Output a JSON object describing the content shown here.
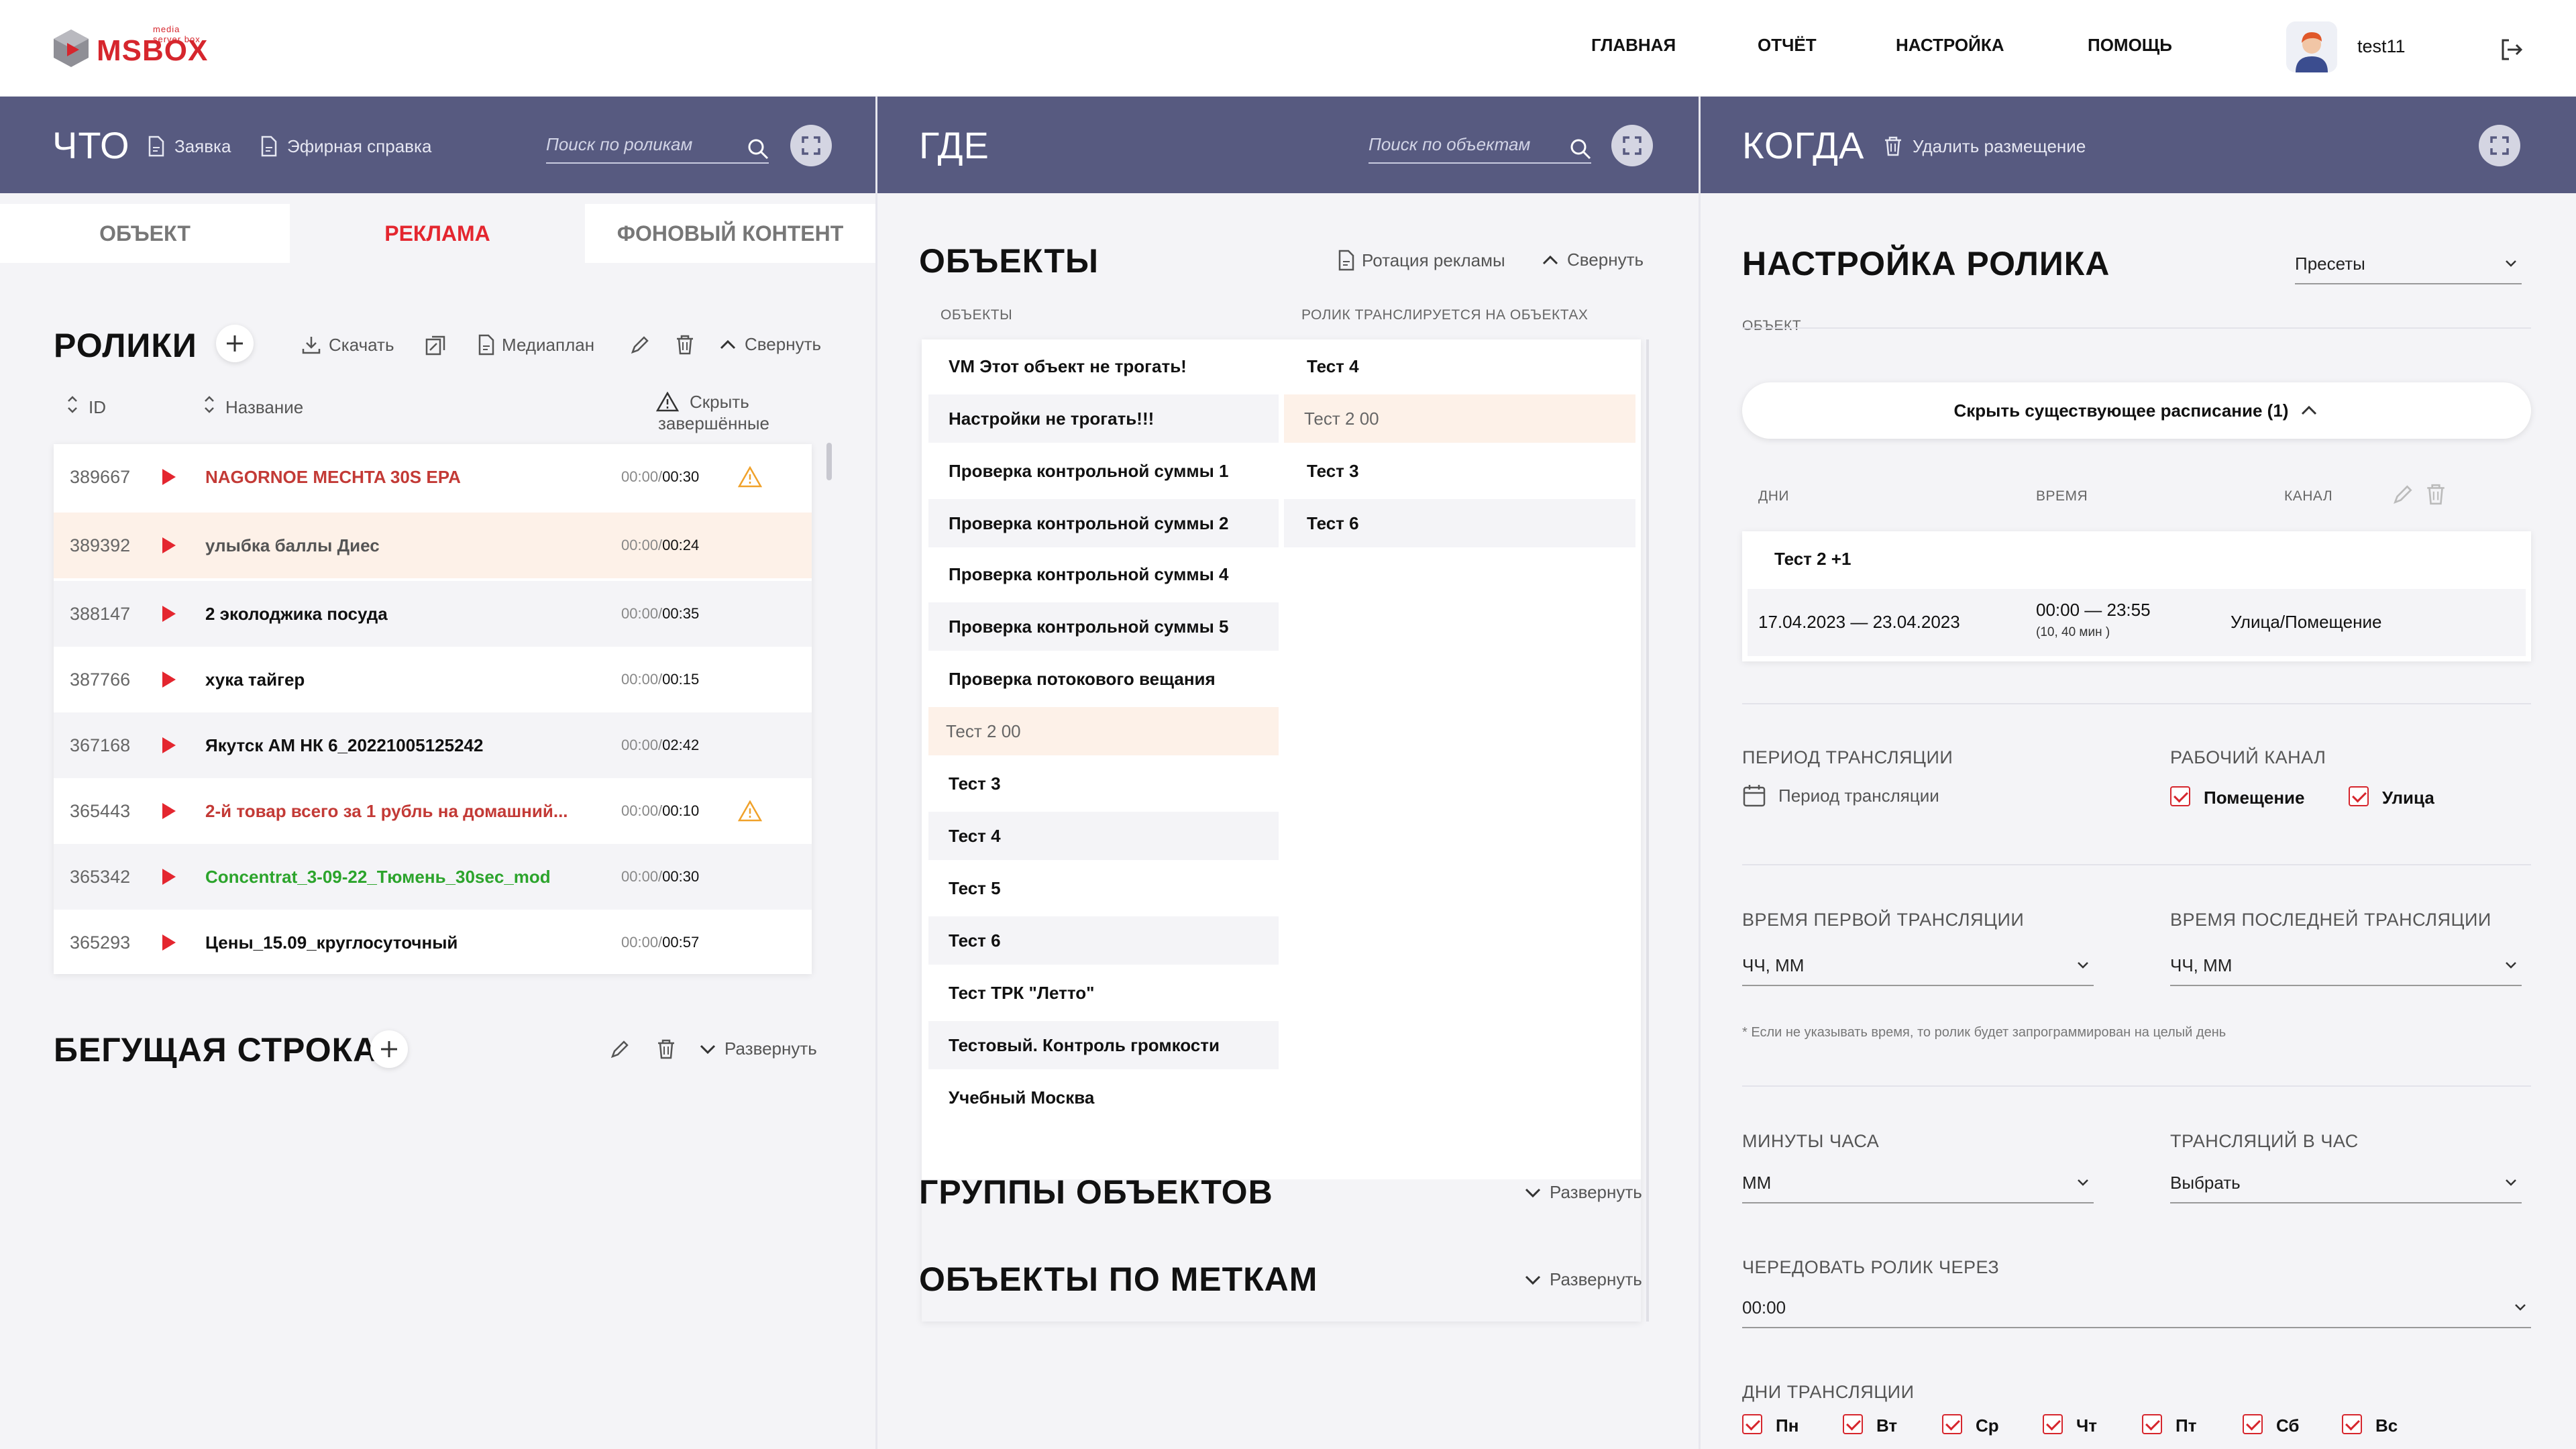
{
  "app": {
    "logo_text": "MSBOX",
    "logo_sub": "media server box",
    "nav": [
      "ГЛАВНАЯ",
      "ОТЧЁТ",
      "НАСТРОЙКА",
      "ПОМОЩЬ"
    ],
    "user": "test11",
    "colors": {
      "accent": "#d6262d",
      "header": "#575a80",
      "selected_row": "#fdf1e8",
      "green_text": "#2ca42c"
    }
  },
  "what": {
    "title": "ЧТО",
    "link_request": "Заявка",
    "link_air": "Эфирная справка",
    "search_placeholder": "Поиск по роликам",
    "tabs": [
      "ОБЪЕКТ",
      "РЕКЛАМА",
      "ФОНОВЫЙ КОНТЕНТ"
    ],
    "active_tab": "РЕКЛАМА",
    "clips": {
      "title": "РОЛИКИ",
      "download": "Скачать",
      "mediaplan": "Медиаплан",
      "collapse": "Свернуть",
      "col_id": "ID",
      "col_name": "Название",
      "col_hide_1": "Скрыть",
      "col_hide_2": "завершённые",
      "rows": [
        {
          "id": "389667",
          "name": "NAGORNOE MECHTA 30S EPA",
          "time_a": "00:00/",
          "time_b": "00:30",
          "style": "red",
          "warn": true
        },
        {
          "id": "389392",
          "name": "улыбка баллы Диес",
          "time_a": "00:00/",
          "time_b": "00:24",
          "style": "muted",
          "warn": false
        },
        {
          "id": "388147",
          "name": "2 эколоджика посуда",
          "time_a": "00:00/",
          "time_b": "00:35",
          "style": "",
          "warn": false
        },
        {
          "id": "387766",
          "name": "хука тайгер",
          "time_a": "00:00/",
          "time_b": "00:15",
          "style": "",
          "warn": false
        },
        {
          "id": "367168",
          "name": "Якутск АМ НК 6_20221005125242",
          "time_a": "00:00/",
          "time_b": "02:42",
          "style": "",
          "warn": false
        },
        {
          "id": "365443",
          "name": "2-й товар всего за 1 рубль на домашний...",
          "time_a": "00:00/",
          "time_b": "00:10",
          "style": "red",
          "warn": true
        },
        {
          "id": "365342",
          "name": "Concentrat_3-09-22_Тюмень_30sec_mod",
          "time_a": "00:00/",
          "time_b": "00:30",
          "style": "green",
          "warn": false
        },
        {
          "id": "365293",
          "name": "Цены_15.09_круглосуточный",
          "time_a": "00:00/",
          "time_b": "00:57",
          "style": "",
          "warn": false
        }
      ]
    },
    "ticker": {
      "title": "БЕГУЩАЯ СТРОКА",
      "expand": "Развернуть"
    }
  },
  "where": {
    "title": "ГДЕ",
    "search_placeholder": "Поиск по объектам",
    "objects": {
      "title": "ОБЪЕКТЫ",
      "rotation": "Ротация рекламы",
      "collapse": "Свернуть",
      "col_left": "ОБЪЕКТЫ",
      "col_right": "РОЛИК ТРАНСЛИРУЕТСЯ НА ОБЪЕКТАХ",
      "left": [
        "VM Этот объект не трогать!",
        "Настройки не трогать!!!",
        "Проверка контрольной суммы 1",
        "Проверка контрольной суммы 2",
        "Проверка контрольной суммы 4",
        "Проверка контрольной суммы 5",
        "Проверка потокового вещания",
        "Тест 2 00",
        "Тест 3",
        "Тест 4",
        "Тест 5",
        "Тест 6",
        "Тест ТРК \"Летто\"",
        "Тестовый. Контроль громкости",
        "Учебный Москва"
      ],
      "right": [
        "Тест 4",
        "Тест 2 00",
        "Тест 3",
        "Тест 6"
      ]
    },
    "groups": {
      "title": "ГРУППЫ ОБЪЕКТОВ",
      "expand": "Развернуть"
    },
    "tags": {
      "title": "ОБЪЕКТЫ ПО МЕТКАМ",
      "expand": "Развернуть"
    }
  },
  "when": {
    "title": "КОГДА",
    "delete": "Удалить размещение",
    "setup_title": "НАСТРОЙКА РОЛИКА",
    "presets": "Пресеты",
    "object_label": "ОБЪЕКТ",
    "hide_schedule": "Скрыть существующее расписание (1)",
    "sched_cols": [
      "ДНИ",
      "ВРЕМЯ",
      "КАНАЛ"
    ],
    "sched_group": "Тест 2 +1",
    "sched_dates": "17.04.2023 — 23.04.2023",
    "sched_time": "00:00 — 23:55",
    "sched_dur": "(10, 40 мин )",
    "sched_channel": "Улица/Помещение",
    "period_label": "ПЕРИОД ТРАНСЛЯЦИИ",
    "period_value": "Период трансляции",
    "channel_label": "РАБОЧИЙ КАНАЛ",
    "channel_opts": [
      "Помещение",
      "Улица"
    ],
    "first_label": "ВРЕМЯ ПЕРВОЙ ТРАНСЛЯЦИИ",
    "last_label": "ВРЕМЯ ПОСЛЕДНЕЙ ТРАНСЛЯЦИИ",
    "first_value": "ЧЧ, ММ",
    "last_value": "ЧЧ, ММ",
    "note": "* Если не указывать время, то ролик будет запрограммирован на целый день",
    "minutes_label": "МИНУТЫ ЧАСА",
    "minutes_value": "ММ",
    "perhour_label": "ТРАНСЛЯЦИЙ В ЧАС",
    "perhour_value": "Выбрать",
    "alternate_label": "ЧЕРЕДОВАТЬ РОЛИК ЧЕРЕЗ",
    "alternate_value": "00:00",
    "days_label": "ДНИ ТРАНСЛЯЦИИ",
    "days": [
      "Пн",
      "Вт",
      "Ср",
      "Чт",
      "Пт",
      "Сб",
      "Вс"
    ]
  }
}
